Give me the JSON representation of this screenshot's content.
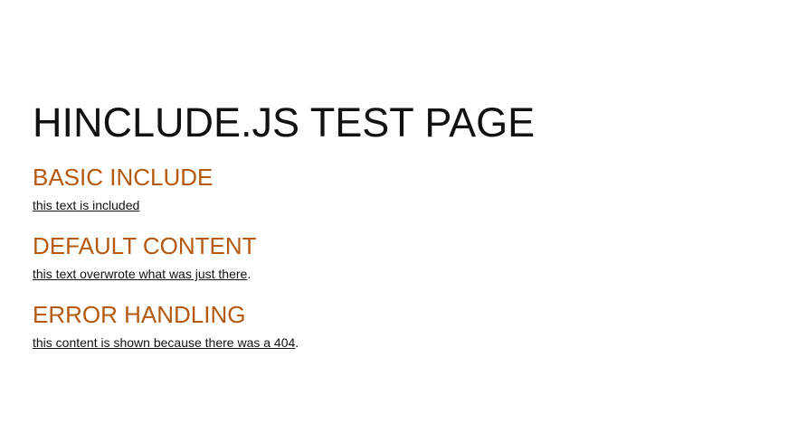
{
  "page": {
    "title": "HINCLUDE.JS TEST PAGE"
  },
  "sections": [
    {
      "heading": "BASIC INCLUDE",
      "included_text": "this text is included",
      "trailing": ""
    },
    {
      "heading": "DEFAULT CONTENT",
      "included_text": "this text overwrote what was just there",
      "trailing": "."
    },
    {
      "heading": "ERROR HANDLING",
      "included_text": "this content is shown because there was a 404",
      "trailing": "."
    }
  ],
  "colors": {
    "heading_accent": "#b5590f",
    "text": "#111111",
    "background": "#ffffff"
  }
}
